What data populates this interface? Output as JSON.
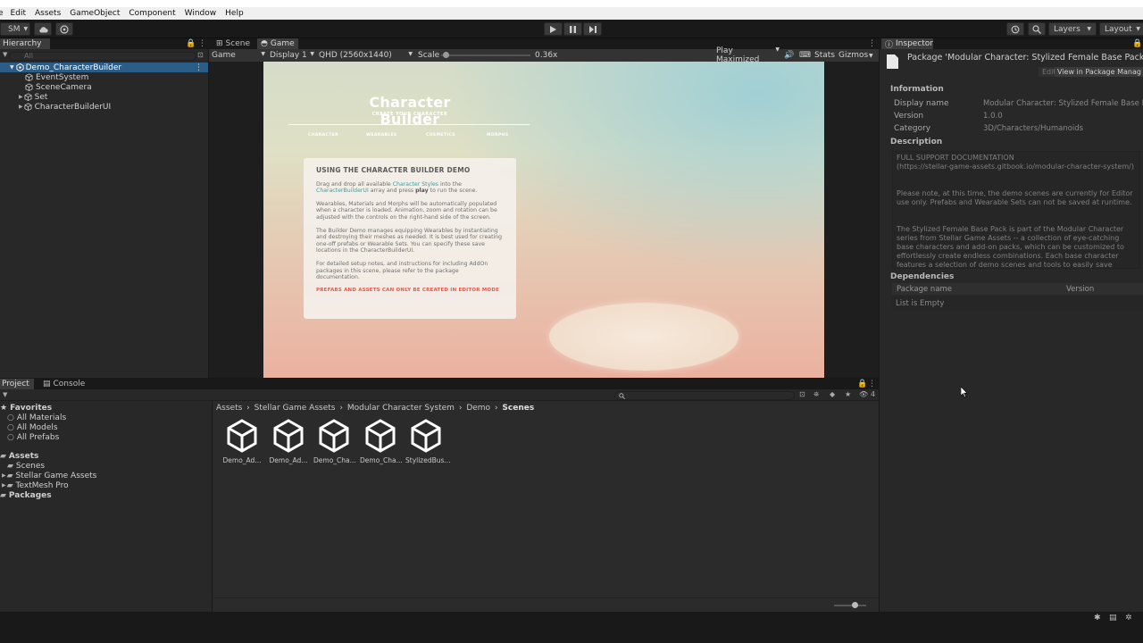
{
  "menu": [
    "e",
    "Edit",
    "Assets",
    "GameObject",
    "Component",
    "Window",
    "Help"
  ],
  "toolbar": {
    "account": "SM",
    "layers": "Layers",
    "layout": "Layout"
  },
  "hierarchy": {
    "tab": "Hierarchy",
    "search_placeholder": "All",
    "items": [
      {
        "label": "Demo_CharacterBuilder"
      },
      {
        "label": "EventSystem"
      },
      {
        "label": "SceneCamera"
      },
      {
        "label": "Set"
      },
      {
        "label": "CharacterBuilderUI"
      }
    ]
  },
  "scene_tabs": {
    "scene": "Scene",
    "game": "Game"
  },
  "game_bar": {
    "mode": "Game",
    "display": "Display 1",
    "resolution": "QHD (2560x1440)",
    "scale_label": "Scale",
    "scale_value": "0.36x",
    "play_mode": "Play Maximized",
    "stats": "Stats",
    "gizmos": "Gizmos",
    "scale_fraction": 0.02
  },
  "game": {
    "title": "Character Builder",
    "subtitle": "CREATE YOUR CHARACTER",
    "nav": [
      "CHARACTER",
      "WEARABLES",
      "COSMETICS",
      "MORPHS"
    ],
    "card": {
      "heading": "USING THE CHARACTER BUILDER DEMO",
      "p1_a": "Drag and drop all available ",
      "p1_hl1": "Character Styles",
      "p1_b": " into the ",
      "p1_hl2": "CharacterBuilderUI",
      "p1_c": " array and press ",
      "p1_bold": "play",
      "p1_d": " to run the scene.",
      "p2": "Wearables, Materials and Morphs will be automatically populated when a character is loaded. Animation, zoom and rotation can be adjusted with the controls on the right-hand side of the screen.",
      "p3": "The Builder Demo manages equipping Wearables by instantiating and destroying their meshes as needed. It is best used for creating one-off prefabs or Wearable Sets. You can specify these save locations in the CharacterBuilderUI.",
      "p4": "For detailed setup notes, and instructions for including AddOn packages in this scene, please refer to the package documentation.",
      "warning": "PREFABS AND ASSETS CAN ONLY BE CREATED IN EDITOR MODE"
    }
  },
  "inspector": {
    "tab": "Inspector",
    "package_title": "Package 'Modular Character: Stylized Female Base Pack' Manif",
    "edit": "Edit",
    "view_pm": "View in Package Manag",
    "information": "Information",
    "display_name_label": "Display name",
    "display_name": "Modular Character: Stylized Female Base Pack",
    "version_label": "Version",
    "version": "1.0.0",
    "category_label": "Category",
    "category": "3D/Characters/Humanoids",
    "description_label": "Description",
    "desc1": "FULL SUPPORT DOCUMENTATION",
    "desc2": "(https://stellar-game-assets.gitbook.io/modular-character-system/)",
    "desc3": "Please note, at this time, the demo scenes are currently for Editor use only. Prefabs and Wearable Sets can not be saved at runtime.",
    "desc4": "The Stylized Female Base Pack is part of the Modular Character series from Stellar Game Assets -- a collection of eye-catching base characters and add-on packs, which can be customized to effortlessly create endless combinations. Each base character features a selection of demo scenes and tools to easily save character prefabs and presets.",
    "dependencies": "Dependencies",
    "col_package": "Package name",
    "col_version": "Version",
    "list_empty": "List is Empty"
  },
  "project": {
    "tab_project": "Project",
    "tab_console": "Console",
    "hidden_count": "4",
    "favorites": "Favorites",
    "fav_items": [
      "All Materials",
      "All Models",
      "All Prefabs"
    ],
    "assets": "Assets",
    "asset_folders": [
      "Scenes",
      "Stellar Game Assets",
      "TextMesh Pro"
    ],
    "packages": "Packages",
    "breadcrumb": [
      "Assets",
      "Stellar Game Assets",
      "Modular Character System",
      "Demo",
      "Scenes"
    ],
    "files": [
      "Demo_Ad...",
      "Demo_Ad...",
      "Demo_Cha...",
      "Demo_Cha...",
      "StylizedBus..."
    ],
    "zoom_fraction": 0.7
  }
}
